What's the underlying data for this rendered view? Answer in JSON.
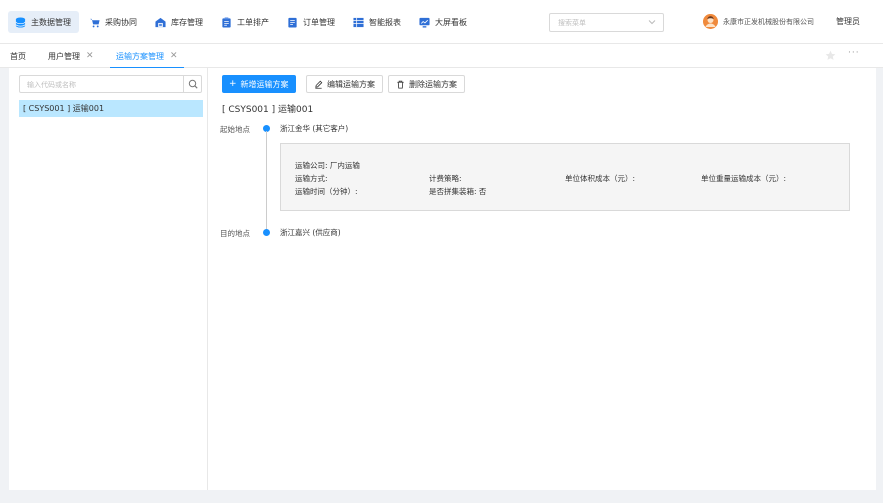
{
  "nav": {
    "items": [
      {
        "label": "主数据管理",
        "icon": "database-icon",
        "active": true
      },
      {
        "label": "采购协同",
        "icon": "shopping-cart-icon"
      },
      {
        "label": "库存管理",
        "icon": "warehouse-icon"
      },
      {
        "label": "工单排产",
        "icon": "clipboard-icon"
      },
      {
        "label": "订单管理",
        "icon": "order-icon"
      },
      {
        "label": "智能报表",
        "icon": "table-icon"
      },
      {
        "label": "大屏看板",
        "icon": "dashboard-icon"
      }
    ],
    "search_placeholder": "搜索菜单",
    "company": "永康市正发机械股份有限公司",
    "user": "管理员"
  },
  "tabs": [
    {
      "label": "首页"
    },
    {
      "label": "用户管理",
      "closable": true
    },
    {
      "label": "运输方案管理",
      "closable": true,
      "active": true
    }
  ],
  "tree": {
    "search_placeholder": "输入代码或名称",
    "nodes": [
      "[ CSYS001 ] 运输001"
    ]
  },
  "toolbar": {
    "add_label": "新增运输方案",
    "edit_label": "编辑运输方案",
    "delete_label": "删除运输方案"
  },
  "scheme": {
    "title": "[ CSYS001 ] 运输001",
    "origin_label": "起始地点",
    "origin_value": "浙江金华 (其它客户)",
    "dest_label": "目的地点",
    "dest_value": "浙江嘉兴 (供应商)",
    "details": {
      "company": "运输公司: 厂内运输",
      "method": "运输方式:",
      "billing": "计费策略:",
      "volume_cost": "单位体积成本（元）:",
      "weight_cost": "单位重量运输成本（元）:",
      "time": "运输时间（分钟）:",
      "consolidation": "是否拼集装箱: 否"
    }
  },
  "colors": {
    "accent": "#1890ff",
    "selected_bg": "#bae7ff"
  }
}
